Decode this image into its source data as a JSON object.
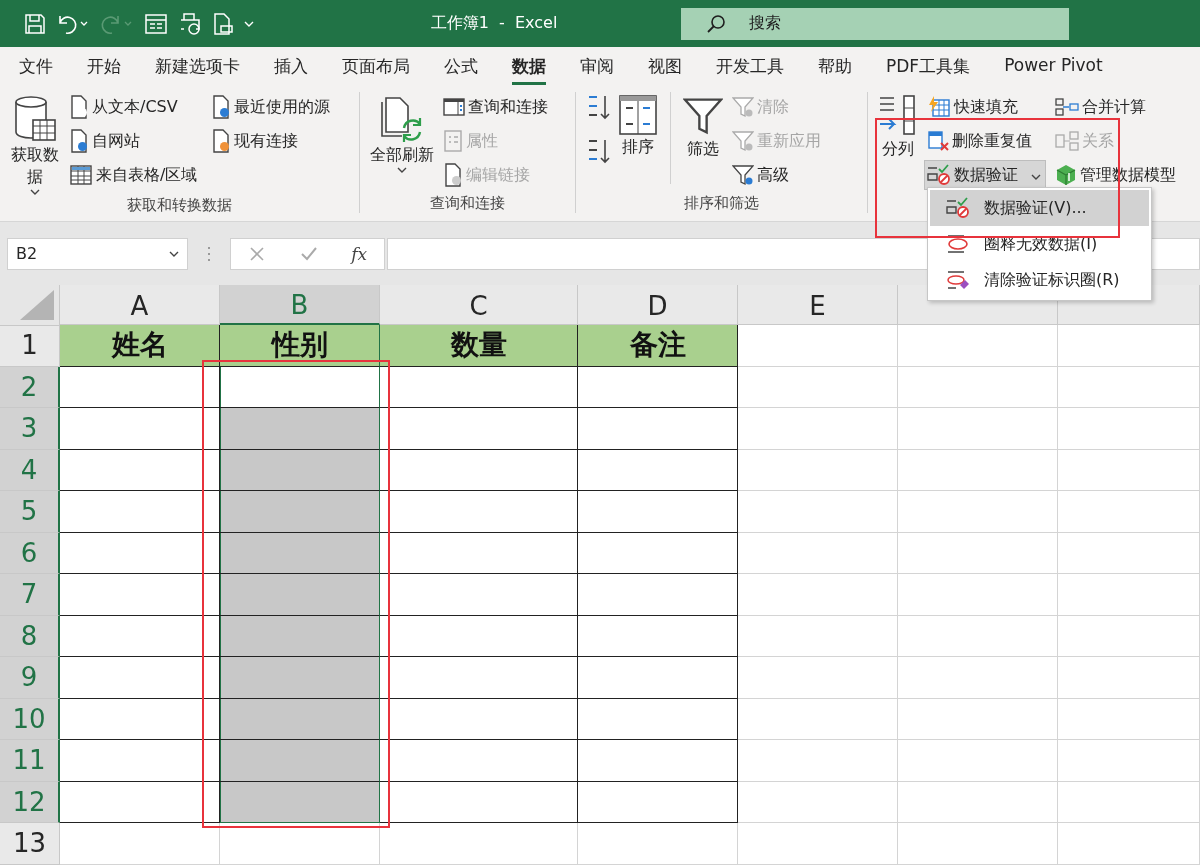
{
  "title_bar": {
    "title": "工作簿1  -  Excel",
    "search": {
      "placeholder": "搜索"
    }
  },
  "tabs": [
    {
      "label": "文件",
      "selected": false
    },
    {
      "label": "开始",
      "selected": false
    },
    {
      "label": "新建选项卡",
      "selected": false
    },
    {
      "label": "插入",
      "selected": false
    },
    {
      "label": "页面布局",
      "selected": false
    },
    {
      "label": "公式",
      "selected": false
    },
    {
      "label": "数据",
      "selected": true
    },
    {
      "label": "审阅",
      "selected": false
    },
    {
      "label": "视图",
      "selected": false
    },
    {
      "label": "开发工具",
      "selected": false
    },
    {
      "label": "帮助",
      "selected": false
    },
    {
      "label": "PDF工具集",
      "selected": false
    },
    {
      "label": "Power Pivot",
      "selected": false
    }
  ],
  "ribbon": {
    "groups": [
      {
        "label": "获取和转换数据",
        "columns": [
          {
            "kind": "large",
            "label": "获取数据",
            "caret": true,
            "disabled": false
          },
          {
            "kind": "stack",
            "items": [
              {
                "label": "从文本/CSV",
                "disabled": false,
                "caret": false,
                "pressed": false
              },
              {
                "label": "自网站",
                "disabled": false,
                "caret": false,
                "pressed": false
              },
              {
                "label": "来自表格/区域",
                "disabled": false,
                "caret": false,
                "pressed": false
              }
            ]
          },
          {
            "kind": "stack",
            "items": [
              {
                "label": "最近使用的源",
                "disabled": false,
                "caret": false,
                "pressed": false
              },
              {
                "label": "现有连接",
                "disabled": false,
                "caret": false,
                "pressed": false
              }
            ]
          }
        ]
      },
      {
        "label": "查询和连接",
        "columns": [
          {
            "kind": "large",
            "label": "全部刷新",
            "caret": true,
            "disabled": false
          },
          {
            "kind": "stack",
            "items": [
              {
                "label": "查询和连接",
                "disabled": false,
                "caret": false,
                "pressed": false
              },
              {
                "label": "属性",
                "disabled": true,
                "caret": false,
                "pressed": false
              },
              {
                "label": "编辑链接",
                "disabled": true,
                "caret": false,
                "pressed": false
              }
            ]
          }
        ]
      },
      {
        "label": "排序和筛选",
        "columns": [
          {
            "kind": "sort"
          },
          {
            "kind": "large",
            "label": "排序",
            "caret": false,
            "disabled": false
          },
          {
            "kind": "divider"
          },
          {
            "kind": "large",
            "label": "筛选",
            "caret": false,
            "disabled": false
          },
          {
            "kind": "stack",
            "items": [
              {
                "label": "清除",
                "disabled": true,
                "caret": false,
                "pressed": false
              },
              {
                "label": "重新应用",
                "disabled": true,
                "caret": false,
                "pressed": false
              },
              {
                "label": "高级",
                "disabled": false,
                "caret": false,
                "pressed": false
              }
            ]
          }
        ]
      },
      {
        "columns": [
          {
            "kind": "large",
            "label": "分列",
            "caret": false,
            "disabled": false
          },
          {
            "kind": "stack",
            "items": [
              {
                "label": "快速填充",
                "disabled": false,
                "caret": false,
                "pressed": false
              },
              {
                "label": "删除重复值",
                "disabled": false,
                "caret": false,
                "pressed": false
              },
              {
                "label": "数据验证",
                "disabled": false,
                "caret": true,
                "pressed": true
              }
            ]
          },
          {
            "kind": "stack",
            "items": [
              {
                "label": "合并计算",
                "disabled": false,
                "caret": false,
                "pressed": false
              },
              {
                "label": "关系",
                "disabled": true,
                "caret": false,
                "pressed": false
              },
              {
                "label": "管理数据模型",
                "disabled": false,
                "caret": false,
                "pressed": false
              }
            ]
          }
        ]
      }
    ]
  },
  "menu": {
    "items": [
      {
        "label": "数据验证(V)...",
        "selected": true
      },
      {
        "label": "圈释无效数据(I)",
        "selected": false
      },
      {
        "label": "清除验证标识圈(R)",
        "selected": false
      }
    ]
  },
  "formula_bar": {
    "name_box": "B2",
    "function_label": "fx"
  },
  "sheet": {
    "columns": [
      {
        "label": "A",
        "selected": false,
        "in_table": true
      },
      {
        "label": "B",
        "selected": true,
        "in_table": true
      },
      {
        "label": "C",
        "selected": false,
        "in_table": true
      },
      {
        "label": "D",
        "selected": false,
        "in_table": true
      },
      {
        "label": "E",
        "selected": false,
        "in_table": false
      },
      {
        "selected": false,
        "in_table": false
      },
      {
        "selected": false,
        "in_table": false
      }
    ],
    "rows": [
      {
        "number": "1",
        "kind": "header",
        "selected": false,
        "in_table": true,
        "cells": [
          "姓名",
          "性别",
          "数量",
          "备注"
        ]
      },
      {
        "number": "2",
        "kind": "blank",
        "selected": true,
        "active": true,
        "in_table": true
      },
      {
        "number": "3",
        "kind": "blank",
        "selected": true,
        "in_table": true
      },
      {
        "number": "4",
        "kind": "blank",
        "selected": true,
        "in_table": true
      },
      {
        "number": "5",
        "kind": "blank",
        "selected": true,
        "in_table": true
      },
      {
        "number": "6",
        "kind": "blank",
        "selected": true,
        "in_table": true
      },
      {
        "number": "7",
        "kind": "blank",
        "selected": true,
        "in_table": true
      },
      {
        "number": "8",
        "kind": "blank",
        "selected": true,
        "in_table": true
      },
      {
        "number": "9",
        "kind": "blank",
        "selected": true,
        "in_table": true
      },
      {
        "number": "10",
        "kind": "blank",
        "selected": true,
        "in_table": true
      },
      {
        "number": "11",
        "kind": "blank",
        "selected": true,
        "in_table": true
      },
      {
        "number": "12",
        "kind": "blank",
        "selected": true,
        "in_table": true
      },
      {
        "number": "13",
        "kind": "blank",
        "selected": false,
        "in_table": false
      }
    ]
  }
}
